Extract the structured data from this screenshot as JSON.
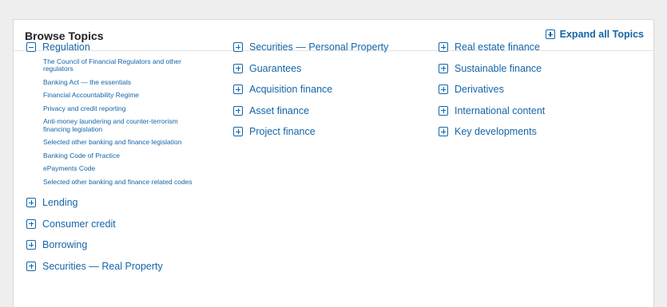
{
  "panel": {
    "title": "Browse Topics",
    "expand_all_label": "Expand all Topics"
  },
  "column1": {
    "expanded_topic": {
      "label": "Regulation",
      "subtopics": [
        "The Council of Financial Regulators and other regulators",
        "Banking Act — the essentials",
        "Financial Accountability Regime",
        "Privacy and credit reporting",
        "Anti-money laundering and counter-terrorism financing legislation",
        "Selected other banking and finance legislation",
        "Banking Code of Practice",
        "ePayments Code",
        "Selected other banking and finance related codes"
      ]
    },
    "topics": [
      "Lending",
      "Consumer credit",
      "Borrowing",
      "Securities — Real Property"
    ]
  },
  "column2": {
    "topics": [
      "Securities — Personal Property",
      "Guarantees",
      "Acquisition finance",
      "Asset finance",
      "Project finance"
    ]
  },
  "column3": {
    "topics": [
      "Real estate finance",
      "Sustainable finance",
      "Derivatives",
      "International content",
      "Key developments"
    ]
  }
}
